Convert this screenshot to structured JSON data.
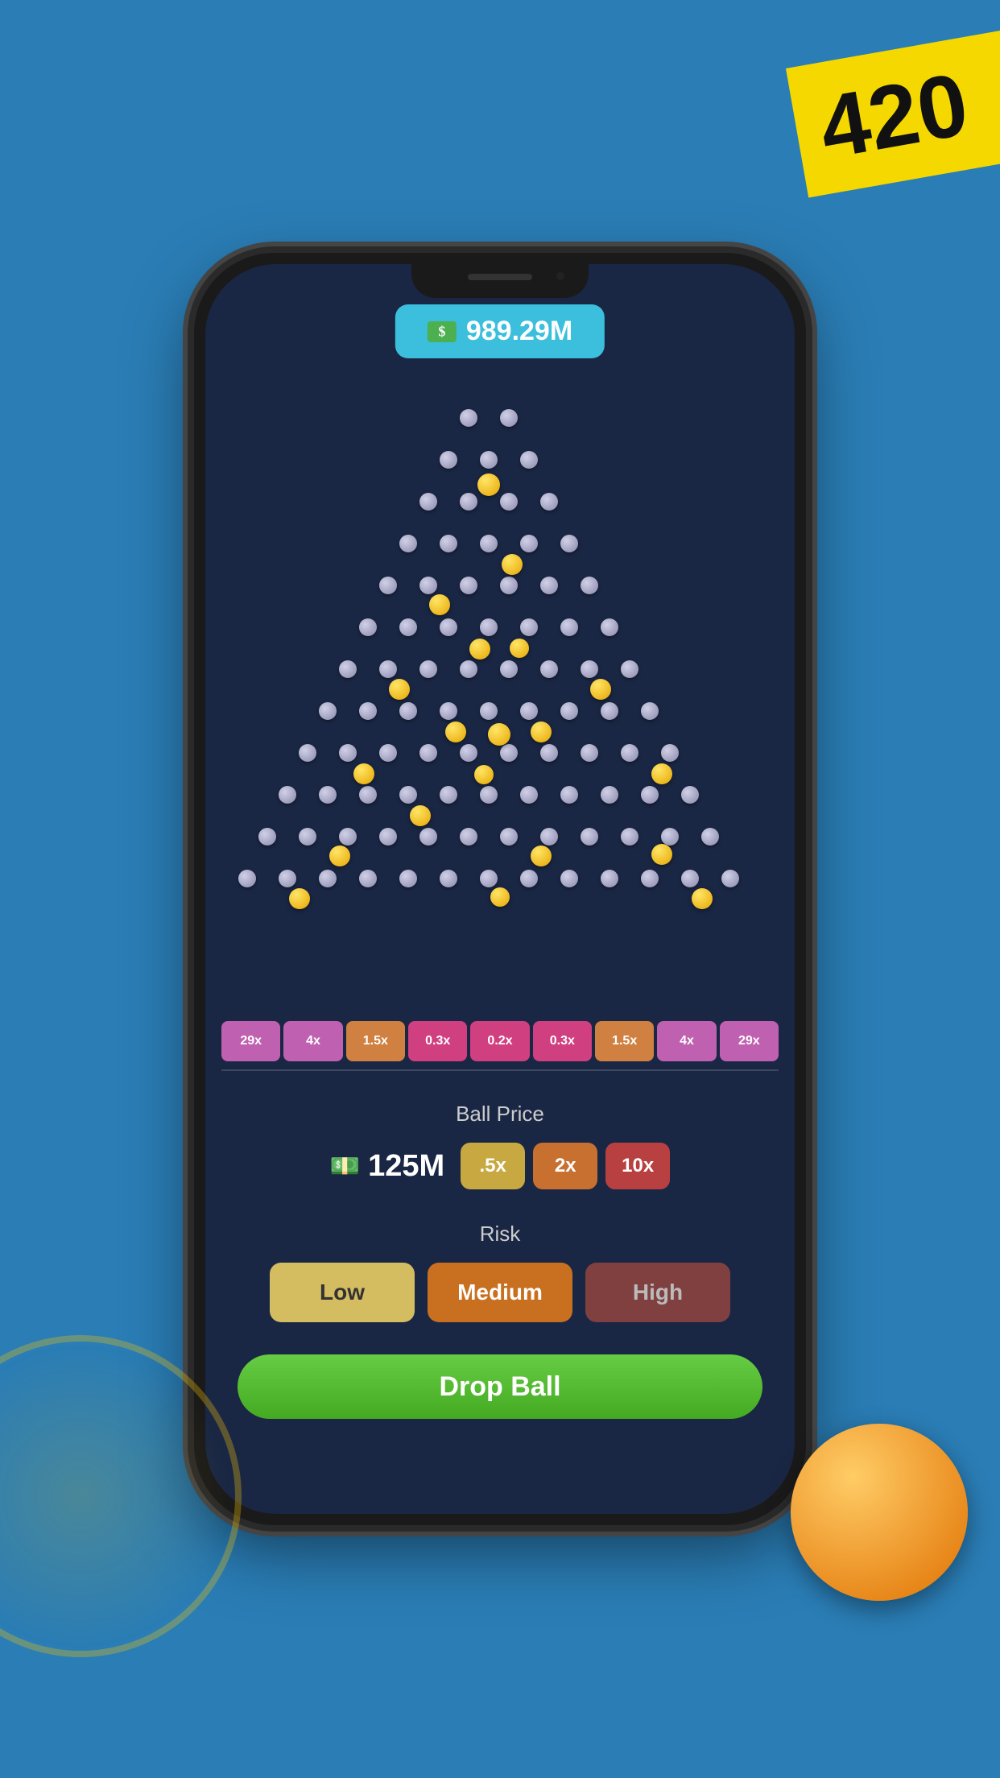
{
  "badge": {
    "text": "420"
  },
  "balance": {
    "icon": "$",
    "amount": "989.29M"
  },
  "multipliers": [
    {
      "label": "29x",
      "type": "high"
    },
    {
      "label": "4x",
      "type": "high"
    },
    {
      "label": "1.5x",
      "type": "med"
    },
    {
      "label": "0.3x",
      "type": "low"
    },
    {
      "label": "0.2x",
      "type": "low"
    },
    {
      "label": "0.3x",
      "type": "low"
    },
    {
      "label": "1.5x",
      "type": "med"
    },
    {
      "label": "4x",
      "type": "high"
    },
    {
      "label": "29x",
      "type": "high"
    }
  ],
  "ball_price": {
    "label": "Ball Price",
    "icon": "$",
    "amount": "125M",
    "options": [
      ".5x",
      "2x",
      "10x"
    ]
  },
  "risk": {
    "label": "Risk",
    "options": [
      "Low",
      "Medium",
      "High"
    ]
  },
  "drop_ball": {
    "label": "Drop Ball"
  }
}
